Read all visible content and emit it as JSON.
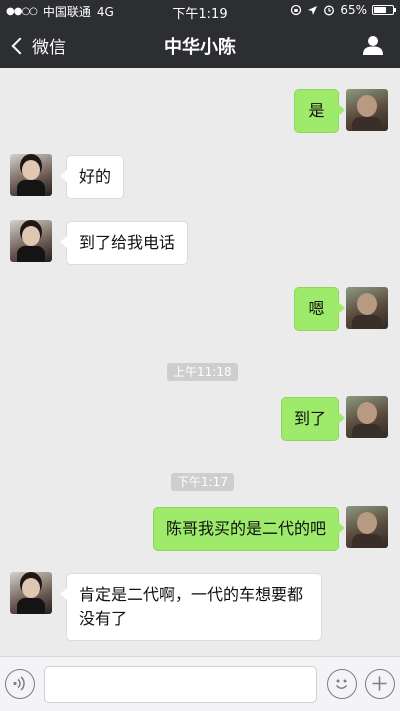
{
  "status_bar": {
    "signal_dots": "●●○○",
    "carrier": "中国联通",
    "network": "4G",
    "time": "下午1:19",
    "battery_percent": "65%",
    "battery_level": 0.65
  },
  "nav": {
    "back_label": "微信",
    "title": "中华小陈"
  },
  "messages": [
    {
      "side": "me",
      "text": "是"
    },
    {
      "side": "other",
      "text": "好的"
    },
    {
      "side": "other",
      "text": "到了给我电话"
    },
    {
      "side": "me",
      "text": "嗯"
    },
    {
      "side": "time",
      "text": "上午11:18"
    },
    {
      "side": "me",
      "text": "到了"
    },
    {
      "side": "time",
      "text": "下午1:17"
    },
    {
      "side": "me",
      "text": "陈哥我买的是二代的吧"
    },
    {
      "side": "other",
      "text": "肯定是二代啊，一代的车想要都没有了"
    }
  ],
  "input_bar": {
    "text": "",
    "icons": [
      "voice-icon",
      "emoji-icon",
      "plus-icon"
    ]
  },
  "colors": {
    "nav_bg": "#2d2e32",
    "chat_bg": "#ebebeb",
    "my_bubble": "#9eea6a",
    "other_bubble": "#ffffff"
  }
}
